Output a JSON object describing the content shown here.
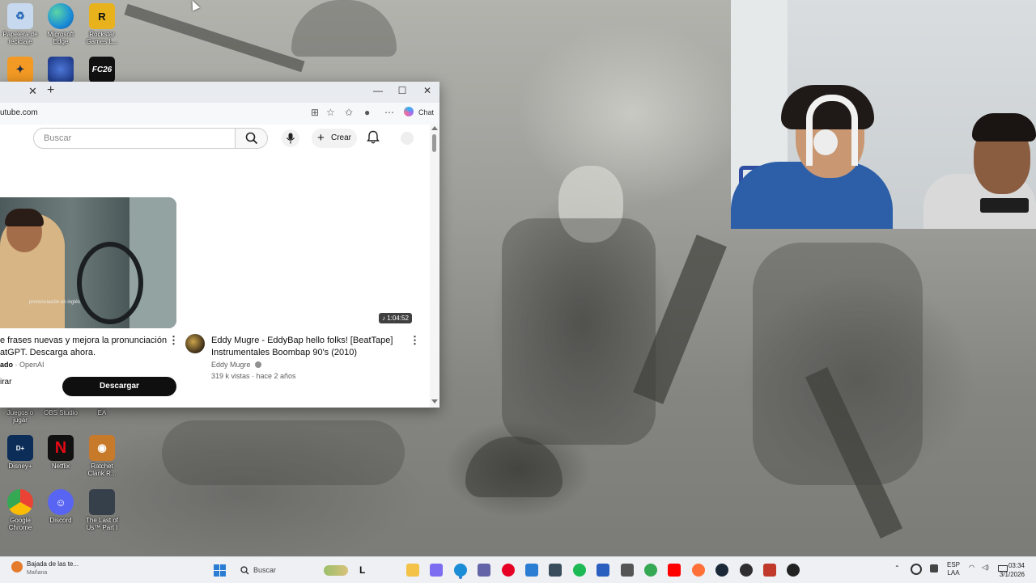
{
  "desktop": {
    "top_icons": [
      {
        "name": "recycle-bin-icon",
        "label": "Papelera de reciclaje",
        "color": "#c7d9ef"
      },
      {
        "name": "edge-icon",
        "label": "Microsoft Edge",
        "color": "#1b8dd6"
      },
      {
        "name": "rockstar-icon",
        "label": "Rockstar Games L...",
        "color": "#e8b21c"
      }
    ],
    "second_row_icons": [
      {
        "name": "cs-icon",
        "label": "",
        "color": "#f39a24"
      },
      {
        "name": "game-blue-icon",
        "label": "",
        "color": "#17317e"
      },
      {
        "name": "fc26-icon",
        "label": "FC26",
        "color": "#111111"
      }
    ],
    "middle_labels": [
      "Juegos o jugar",
      "OBS Studio",
      "EA"
    ],
    "bottom_icons_row1": [
      {
        "name": "disney-icon",
        "label": "Disney+",
        "color": "#0b2d58"
      },
      {
        "name": "netflix-icon",
        "label": "Netflix",
        "color": "#e50914"
      },
      {
        "name": "ratchet-icon",
        "label": "Ratchet Clank R...",
        "color": "#c77a2a"
      }
    ],
    "bottom_icons_row2": [
      {
        "name": "chrome-icon",
        "label": "Google Chrome",
        "color": "#2ea44f"
      },
      {
        "name": "discord-icon",
        "label": "Discord",
        "color": "#5865f2"
      },
      {
        "name": "tlou-icon",
        "label": "The Last of Us™ Part I",
        "color": "#36404a"
      }
    ]
  },
  "browser": {
    "url": "utube.com",
    "chat_label": "Chat",
    "search_placeholder": "Buscar",
    "create_label": "Crear",
    "ad": {
      "title_line1": "e frases nuevas y mejora la pronunciación",
      "title_line2": "atGPT. Descarga ahora.",
      "sponsor_bold": "ado",
      "sponsor_rest": " · OpenAI",
      "thumb_caption": "pronunciación en inglés",
      "left_button": "irar",
      "download_label": "Descargar"
    },
    "video": {
      "duration": "1:04:52",
      "title": "Eddy Mugre - EddyBap hello folks! [BeatTape] Instrumentales Boombap 90's (2010)",
      "channel": "Eddy Mugre",
      "stats": "319 k vistas · hace 2 años"
    }
  },
  "taskbar": {
    "weather_title": "Bajada de las te...",
    "weather_sub": "Mañana",
    "search_label": "Buscar",
    "lang_top": "ESP",
    "lang_bottom": "LAA",
    "time": "03:34",
    "date": "3/1/2026",
    "pinned": [
      {
        "name": "file-explorer-icon",
        "color": "#f4c246"
      },
      {
        "name": "copilot-icon",
        "color": "#7b6cf2"
      },
      {
        "name": "edge-taskbar-icon",
        "color": "#1b8dd6"
      },
      {
        "name": "teams-icon",
        "color": "#6264a7"
      },
      {
        "name": "pinterest-icon",
        "color": "#e60023"
      },
      {
        "name": "store-icon",
        "color": "#2b7cd3"
      },
      {
        "name": "terminal-icon",
        "color": "#3a4d5c"
      },
      {
        "name": "spotify-icon",
        "color": "#1db954"
      },
      {
        "name": "app-blue-icon",
        "color": "#2a5ebf"
      },
      {
        "name": "game-controller-icon",
        "color": "#555555"
      },
      {
        "name": "chrome-taskbar-icon",
        "color": "#34a853"
      },
      {
        "name": "youtube-icon",
        "color": "#ff0000"
      },
      {
        "name": "firefox-icon",
        "color": "#ff7139"
      },
      {
        "name": "steam-icon",
        "color": "#1b2838"
      },
      {
        "name": "obs-icon",
        "color": "#302e31"
      },
      {
        "name": "video-editor-icon",
        "color": "#c0392b"
      },
      {
        "name": "media-player-icon",
        "color": "#222222"
      }
    ]
  }
}
